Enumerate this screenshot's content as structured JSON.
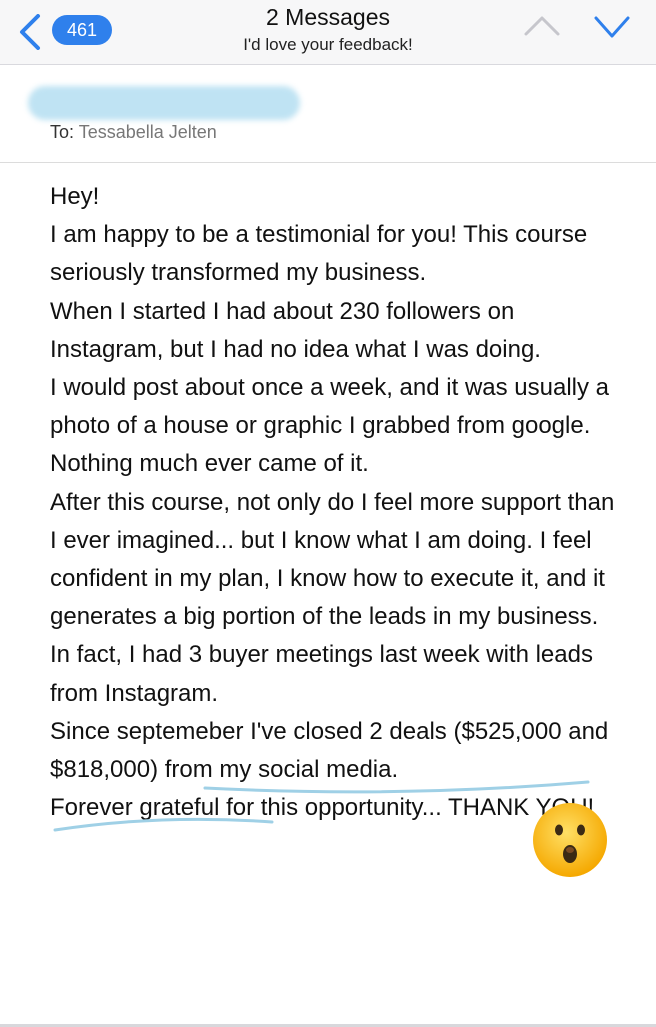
{
  "nav": {
    "badge_count": "461",
    "title": "2 Messages",
    "subtitle": "I'd love your feedback!",
    "colors": {
      "accent": "#2f80ec"
    },
    "icons": {
      "back": "chevron-left-icon",
      "previous": "chevron-up-icon",
      "next": "chevron-down-icon"
    }
  },
  "message": {
    "to_label": "To:",
    "recipient": "Tessabella Jelten",
    "body_lines": [
      "Hey!",
      "I am happy to be a testimonial for you! This course seriously transformed my business.",
      "When I started I had about 230 followers on Instagram, but I had no idea what I was doing.",
      "I would post about once a week, and it was usually a photo of a house or graphic I grabbed from google. Nothing much ever came of it.",
      "After this course, not only do I feel more support than I ever imagined... but I know what I am doing. I feel confident in my plan, I know how to execute it, and it generates a big portion of the leads in my business.",
      "In fact, I had 3 buyer meetings last week with leads from Instagram.",
      "Since septemeber I've closed 2 deals ($525,000 and $818,000) from my social media.",
      "Forever grateful for this opportunity... THANK YOU!"
    ],
    "emoji": "astonished-face"
  }
}
